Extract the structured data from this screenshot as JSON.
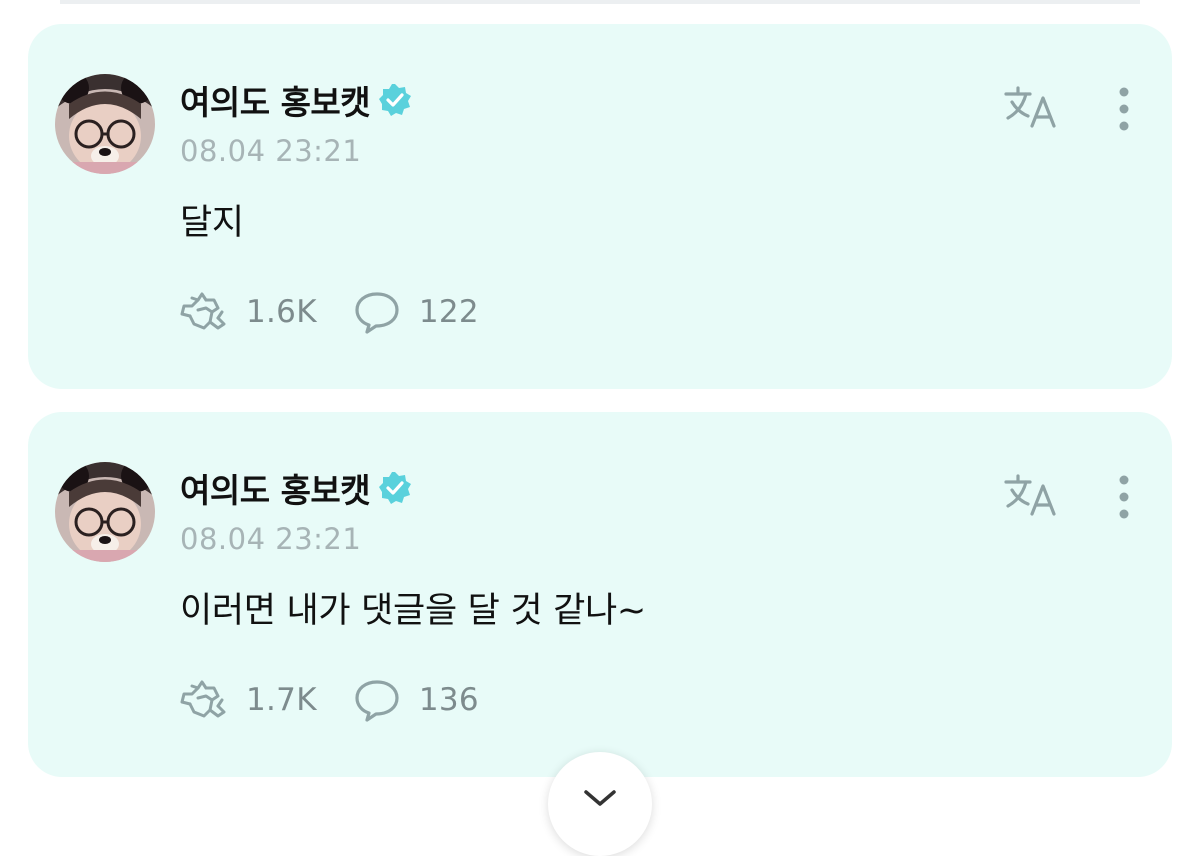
{
  "posts": [
    {
      "username": "여의도 홍보캣",
      "verified": true,
      "timestamp": "08.04 23:21",
      "message": "달지",
      "likes": "1.6K",
      "comments": "122"
    },
    {
      "username": "여의도 홍보캣",
      "verified": true,
      "timestamp": "08.04 23:21",
      "message": "이러면 내가 댓글을 달 것 같나~",
      "likes": "1.7K",
      "comments": "136"
    }
  ],
  "icons": {
    "translate": "translate-icon",
    "more": "more-vertical-icon",
    "like": "heart-hands-icon",
    "comment": "speech-bubble-icon",
    "verified": "verified-badge-icon",
    "scroll": "chevron-down-icon"
  },
  "colors": {
    "card_background": "#e8fbf8",
    "verified_badge": "#5ad1dc",
    "icon_gray": "#8fa3a5",
    "timestamp": "#a7b4b6",
    "count": "#7d8b8d"
  }
}
